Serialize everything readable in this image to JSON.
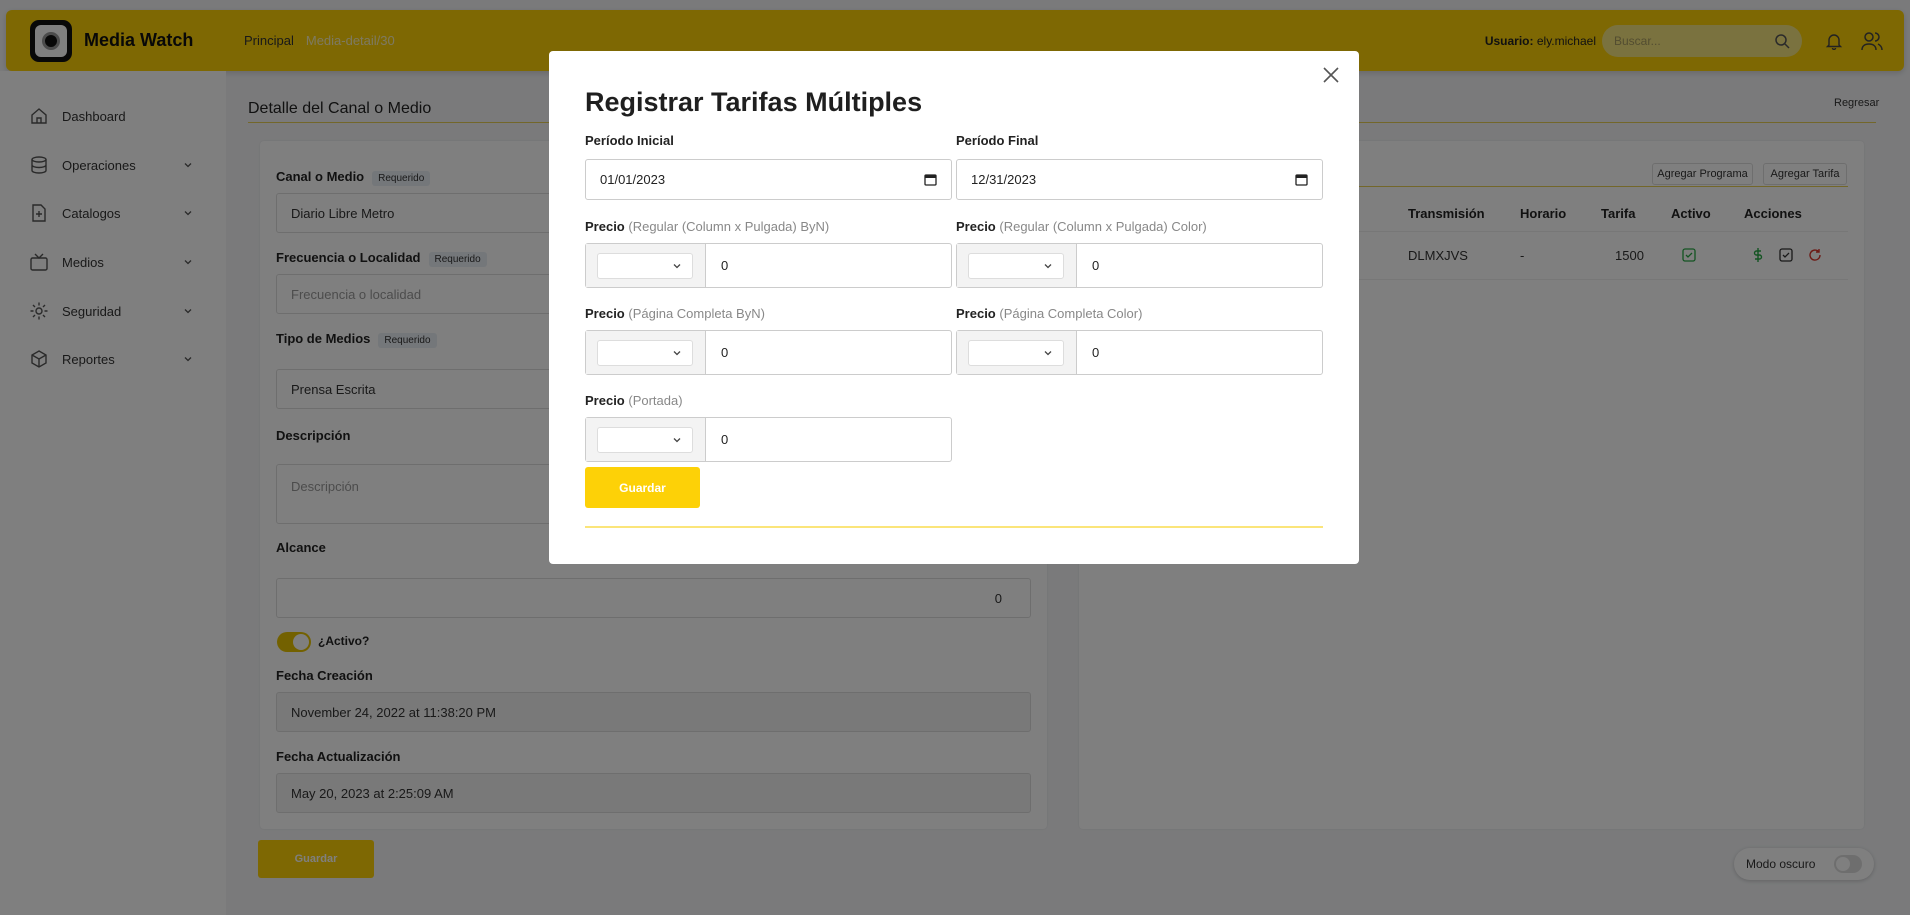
{
  "app": {
    "name": "Media Watch"
  },
  "breadcrumb": {
    "home": "Principal",
    "current": "Media-detail/30"
  },
  "header": {
    "user_label": "Usuario:",
    "user_name": "ely.michael",
    "search_placeholder": "Buscar..."
  },
  "sidebar": {
    "items": [
      {
        "label": "Dashboard",
        "icon": "home-icon"
      },
      {
        "label": "Operaciones",
        "icon": "database-icon"
      },
      {
        "label": "Catalogos",
        "icon": "file-plus-icon"
      },
      {
        "label": "Medios",
        "icon": "tv-icon"
      },
      {
        "label": "Seguridad",
        "icon": "gear-icon"
      },
      {
        "label": "Reportes",
        "icon": "box-icon"
      }
    ]
  },
  "page": {
    "title": "Detalle del Canal o Medio",
    "back_label": "Regresar"
  },
  "form": {
    "required_badge": "Requerido",
    "canal_label": "Canal o Medio",
    "canal_value": "Diario Libre Metro",
    "frecuencia_label": "Frecuencia o Localidad",
    "frecuencia_placeholder": "Frecuencia o localidad",
    "tipo_label": "Tipo de Medios",
    "tipo_value": "Prensa Escrita",
    "descripcion_label": "Descripción",
    "descripcion_placeholder": "Descripción",
    "alcance_label": "Alcance",
    "alcance_value": "0",
    "activo_label": "¿Activo?",
    "fecha_creacion_label": "Fecha Creación",
    "fecha_creacion_value": "November 24, 2022 at 11:38:20 PM",
    "fecha_actualizacion_label": "Fecha Actualización",
    "fecha_actualizacion_value": "May 20, 2023 at 2:25:09 AM",
    "save_label": "Guardar"
  },
  "rates_panel": {
    "add_program": "Agregar Programa",
    "add_rate": "Agregar Tarifa",
    "columns": [
      "Transmisión",
      "Horario",
      "Tarifa",
      "Activo",
      "Acciones"
    ],
    "rows": [
      {
        "transmision": "DLMXJVS",
        "horario": "-",
        "tarifa": "1500"
      }
    ]
  },
  "dark_mode": {
    "label": "Modo oscuro"
  },
  "modal": {
    "title": "Registrar Tarifas Múltiples",
    "periodo_inicial_label": "Período Inicial",
    "periodo_inicial_value": "01/01/2023",
    "periodo_final_label": "Período Final",
    "periodo_final_value": "12/31/2023",
    "price_word": "Precio",
    "prices": [
      {
        "sub": "(Regular (Column x Pulgada) ByN)",
        "value": "0"
      },
      {
        "sub": "(Regular (Column x Pulgada) Color)",
        "value": "0"
      },
      {
        "sub": "(Página Completa ByN)",
        "value": "0"
      },
      {
        "sub": "(Página Completa Color)",
        "value": "0"
      },
      {
        "sub": "(Portada)",
        "value": "0"
      }
    ],
    "save_label": "Guardar"
  }
}
